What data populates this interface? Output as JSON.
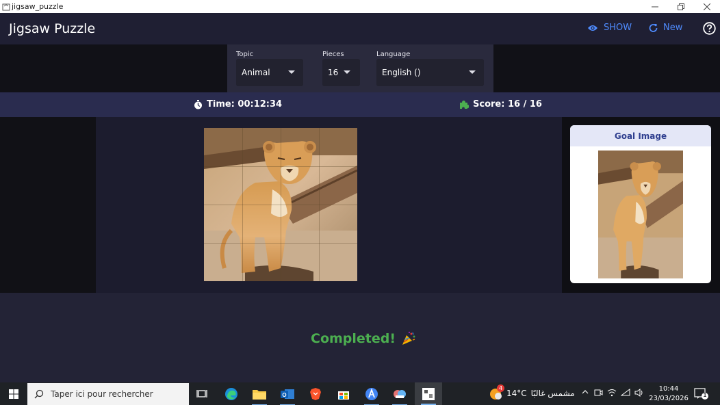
{
  "window": {
    "title": "jigsaw_puzzle"
  },
  "header": {
    "title": "Jigsaw Puzzle",
    "show_label": "SHOW",
    "new_label": "New"
  },
  "settings": {
    "topic": {
      "label": "Topic",
      "value": "Animal"
    },
    "pieces": {
      "label": "Pieces",
      "value": "16"
    },
    "language": {
      "label": "Language",
      "value": "English ()"
    }
  },
  "status": {
    "time_label": "Time: 00:12:34",
    "score_label": "Score: 16 / 16"
  },
  "goal": {
    "title": "Goal Image"
  },
  "completion": {
    "text": "Completed!"
  },
  "taskbar": {
    "search_placeholder": "Taper ici pour rechercher",
    "weather_badge": "4",
    "weather_temp": "14°C",
    "weather_text": "مشمس غالبًا",
    "time": "10:44",
    "date": "23/03/2026",
    "notification_count": "1"
  },
  "colors": {
    "accent": "#4f8cff",
    "success": "#4caf50",
    "status_bar": "#2a2c4f",
    "goal_header": "#e4e7f7"
  }
}
